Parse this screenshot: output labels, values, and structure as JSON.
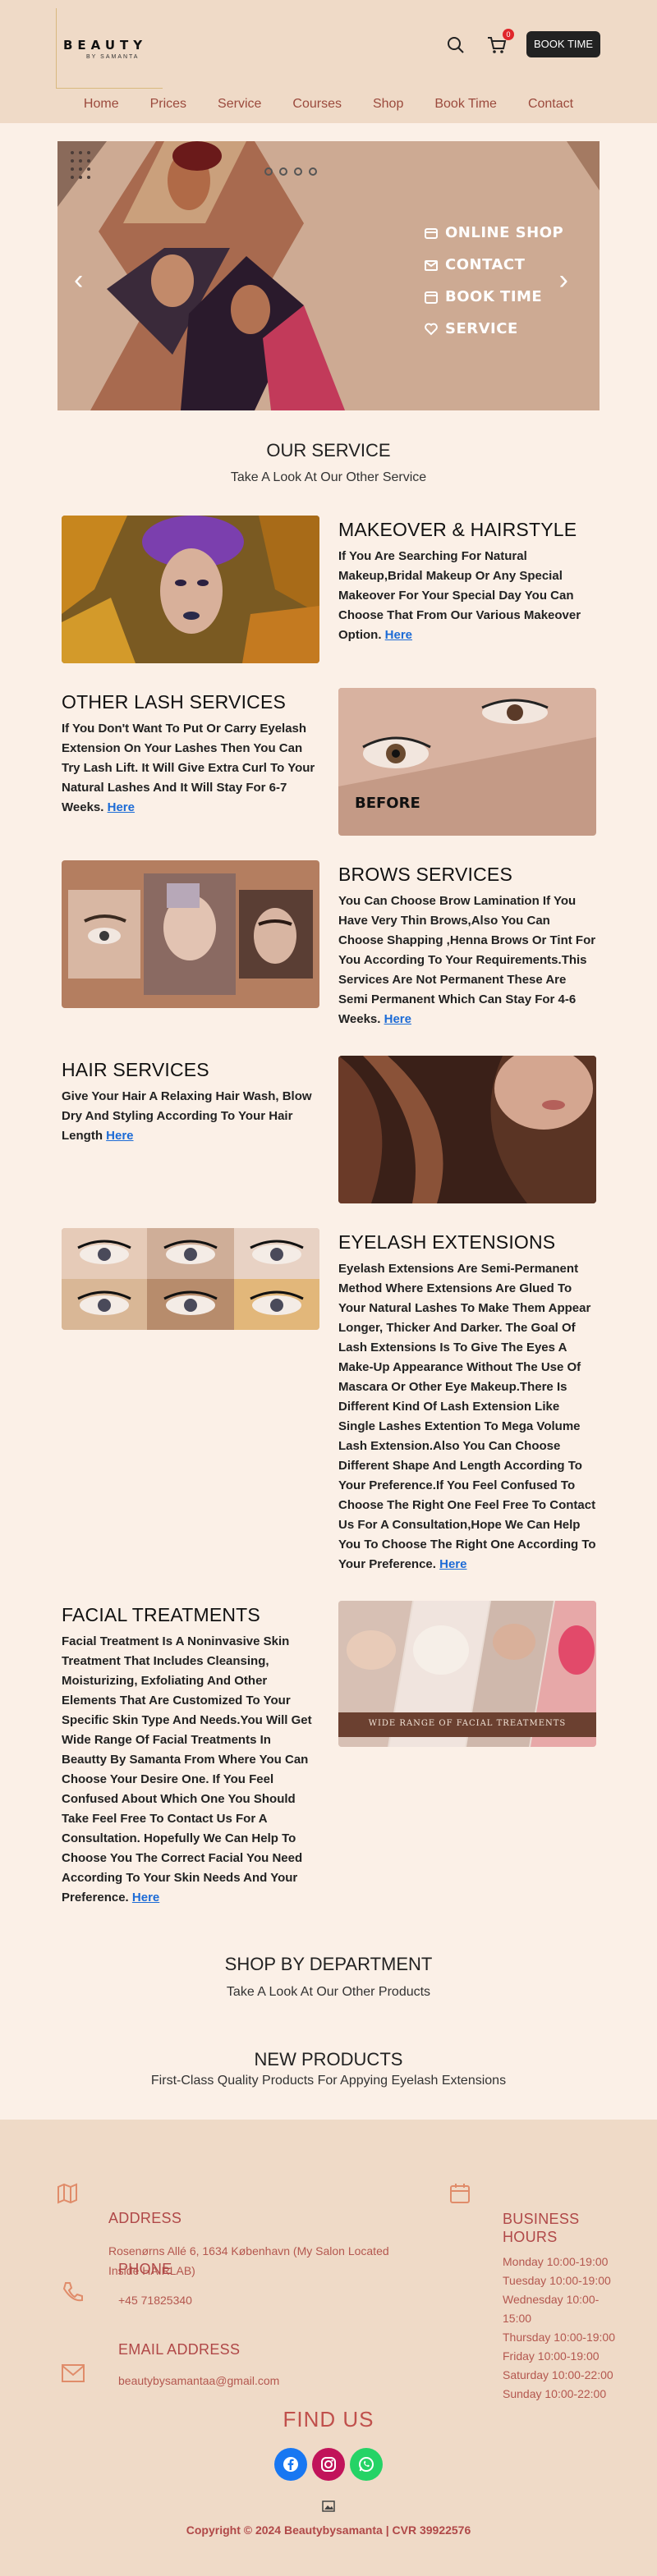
{
  "header": {
    "logo_title": "BEAUTY",
    "logo_subtitle": "BY SAMANTA",
    "cart_count": "0",
    "book_label": "BOOK TIME",
    "nav": [
      "Home",
      "Prices",
      "Service",
      "Courses",
      "Shop",
      "Book Time",
      "Contact"
    ]
  },
  "hero": {
    "menu": [
      "ONLINE SHOP",
      "CONTACT",
      "BOOK TIME",
      "SERVICE"
    ],
    "prev_icon": "chevron-left-icon",
    "next_icon": "chevron-right-icon"
  },
  "our_service": {
    "title": "OUR SERVICE",
    "subtitle": "Take A Look At Our Other Service"
  },
  "services": [
    {
      "title": "MAKEOVER & HAIRSTYLE",
      "desc": "If You Are Searching For Natural Makeup,Bridal Makeup Or Any Special Makeover For Your Special Day You Can Choose That From Our Various Makeover Option.",
      "link": "Here"
    },
    {
      "title": "OTHER LASH SERVICES",
      "desc": "If You Don't Want To Put Or Carry Eyelash Extension On Your Lashes Then You Can Try Lash Lift. It Will Give Extra Curl To Your Natural Lashes And It Will Stay For 6-7 Weeks.",
      "link": "Here",
      "image_caption": "BEFORE"
    },
    {
      "title": "BROWS SERVICES",
      "desc": "You Can Choose Brow Lamination If You Have Very Thin Brows,Also You Can Choose Shapping ,Henna Brows Or Tint For You According To Your Requirements.This Services Are Not Permanent These Are Semi Permanent Which Can Stay For 4-6 Weeks.",
      "link": "Here"
    },
    {
      "title": "HAIR SERVICES",
      "desc": "Give Your Hair A Relaxing Hair Wash, Blow Dry And Styling According To Your Hair Length",
      "link": "Here"
    },
    {
      "title": "EYELASH EXTENSIONS",
      "desc": "Eyelash Extensions Are Semi-Permanent Method Where Extensions Are Glued To Your Natural Lashes To Make Them Appear Longer, Thicker And Darker. The Goal Of Lash Extensions Is To Give The Eyes A Make-Up Appearance Without The Use Of Mascara Or Other Eye Makeup.There Is Different Kind Of Lash Extension Like Single Lashes Extention To Mega Volume Lash Extension.Also You Can Choose Different Shape And Length According To Your Preference.If You Feel Confused To Choose The Right One Feel Free To Contact Us For A Consultation,Hope We Can Help You To Choose The Right One According To Your Preference.",
      "link": "Here"
    },
    {
      "title": "FACIAL TREATMENTS",
      "desc": "Facial Treatment Is A Noninvasive Skin Treatment That Includes Cleansing, Moisturizing, Exfoliating And Other Elements That Are Customized To Your Specific Skin Type And Needs.You Will Get Wide Range Of Facial Treatments In Beautty By Samanta From Where You Can Choose Your Desire One. If You Feel Confused About Which One You Should Take Feel Free To Contact Us For A Consultation. Hopefully We Can Help To Choose You The Correct Facial You Need According To Your Skin Needs And Your Preference.",
      "link": "Here",
      "image_caption": "WIDE RANGE OF FACIAL TREATMENTS"
    }
  ],
  "shop": {
    "title": "SHOP BY DEPARTMENT",
    "subtitle": "Take A Look At Our Other Products"
  },
  "new_products": {
    "title": "NEW PRODUCTS",
    "subtitle": "First-Class Quality Products For Appying Eyelash Extensions"
  },
  "footer": {
    "address_title": "ADDRESS",
    "address": "Rosenørns Allé 6, 1634 København (My Salon Located Inside HAIRLAB)",
    "phone_title": "PHONE",
    "phone": "+45 71825340",
    "email_title": "EMAIL ADDRESS",
    "email": "beautybysamantaa@gmail.com",
    "hours_title": "BUSINESS HOURS",
    "hours": [
      "Monday 10:00-19:00",
      "Tuesday 10:00-19:00",
      "Wednesday 10:00-15:00",
      "Thursday 10:00-19:00",
      "Friday 10:00-19:00",
      "Saturday 10:00-22:00",
      "Sunday 10:00-22:00"
    ],
    "find_us": "FIND US",
    "copyright": "Copyright © 2024 Beautybysamanta | CVR 39922576"
  },
  "colors": {
    "header_bg": "#efdac7",
    "page_bg": "#fbf0e7",
    "accent": "#b04848",
    "link": "#1c6bd6",
    "facebook": "#1877f2",
    "instagram": "#c1135a",
    "whatsapp": "#25d366"
  }
}
